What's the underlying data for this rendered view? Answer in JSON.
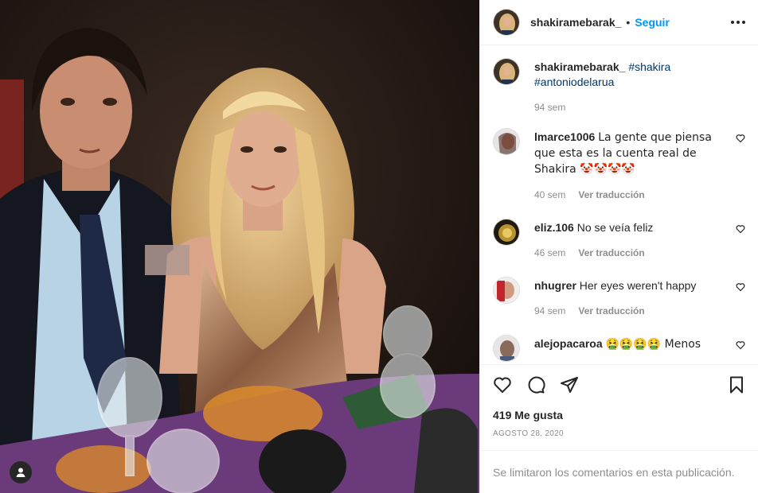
{
  "header": {
    "username": "shakiramebarak_",
    "separator": "•",
    "follow_label": "Seguir"
  },
  "caption": {
    "username": "shakiramebarak_",
    "tags": [
      "#shakira",
      "#antoniodelarua"
    ],
    "time": "94 sem"
  },
  "comments": [
    {
      "username": "lmarce1006",
      "text": "La gente que piensa que esta es la cuenta real de Shakira 🤡🤡🤡🤡",
      "time": "40 sem",
      "translate": "Ver traducción"
    },
    {
      "username": "eliz.106",
      "text": "No se veía feliz",
      "time": "46 sem",
      "translate": "Ver traducción"
    },
    {
      "username": "nhugrer",
      "text": "Her eyes weren't happy",
      "time": "94 sem",
      "translate": "Ver traducción"
    },
    {
      "username": "alejopacaroa",
      "text": "🤮🤮🤮🤮 Menos",
      "time": "",
      "translate": ""
    }
  ],
  "likes": "419 Me gusta",
  "date": "AGOSTO 28, 2020",
  "comments_disabled": "Se limitaron los comentarios en esta publicación.",
  "icons": {
    "like": "heart-icon",
    "comment": "comment-icon",
    "share": "paper-plane-icon",
    "save": "bookmark-icon",
    "more": "more-options-icon",
    "profile": "person-icon"
  },
  "colors": {
    "accent": "#0095f6",
    "text": "#262626",
    "muted": "#8e8e8e",
    "hashtag": "#00376b"
  }
}
